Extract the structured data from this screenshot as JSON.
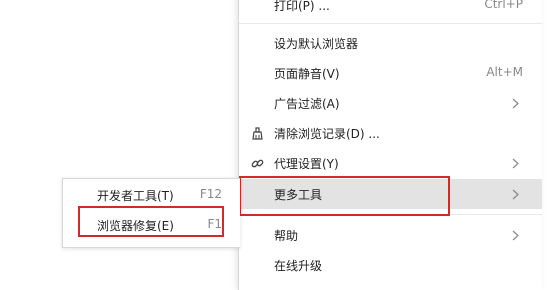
{
  "menu": {
    "print": {
      "label": "打印(P) ...",
      "shortcut": "Ctrl+P"
    },
    "set_default": {
      "label": "设为默认浏览器"
    },
    "mute": {
      "label": "页面静音(V)",
      "shortcut": "Alt+M"
    },
    "ad_filter": {
      "label": "广告过滤(A)"
    },
    "clear_history": {
      "label": "清除浏览记录(D) ..."
    },
    "proxy": {
      "label": "代理设置(Y)"
    },
    "more_tools": {
      "label": "更多工具"
    },
    "help": {
      "label": "帮助"
    },
    "update": {
      "label": "在线升级"
    }
  },
  "submenu": {
    "dev_tools": {
      "label": "开发者工具(T)",
      "shortcut": "F12"
    },
    "repair": {
      "label": "浏览器修复(E)",
      "shortcut": "F1"
    }
  },
  "colors": {
    "highlight_box": "#d22a2a",
    "hover_bg": "#e3e3e3"
  },
  "icons": [
    "broom-icon",
    "link-icon",
    "chevron-right-icon"
  ]
}
